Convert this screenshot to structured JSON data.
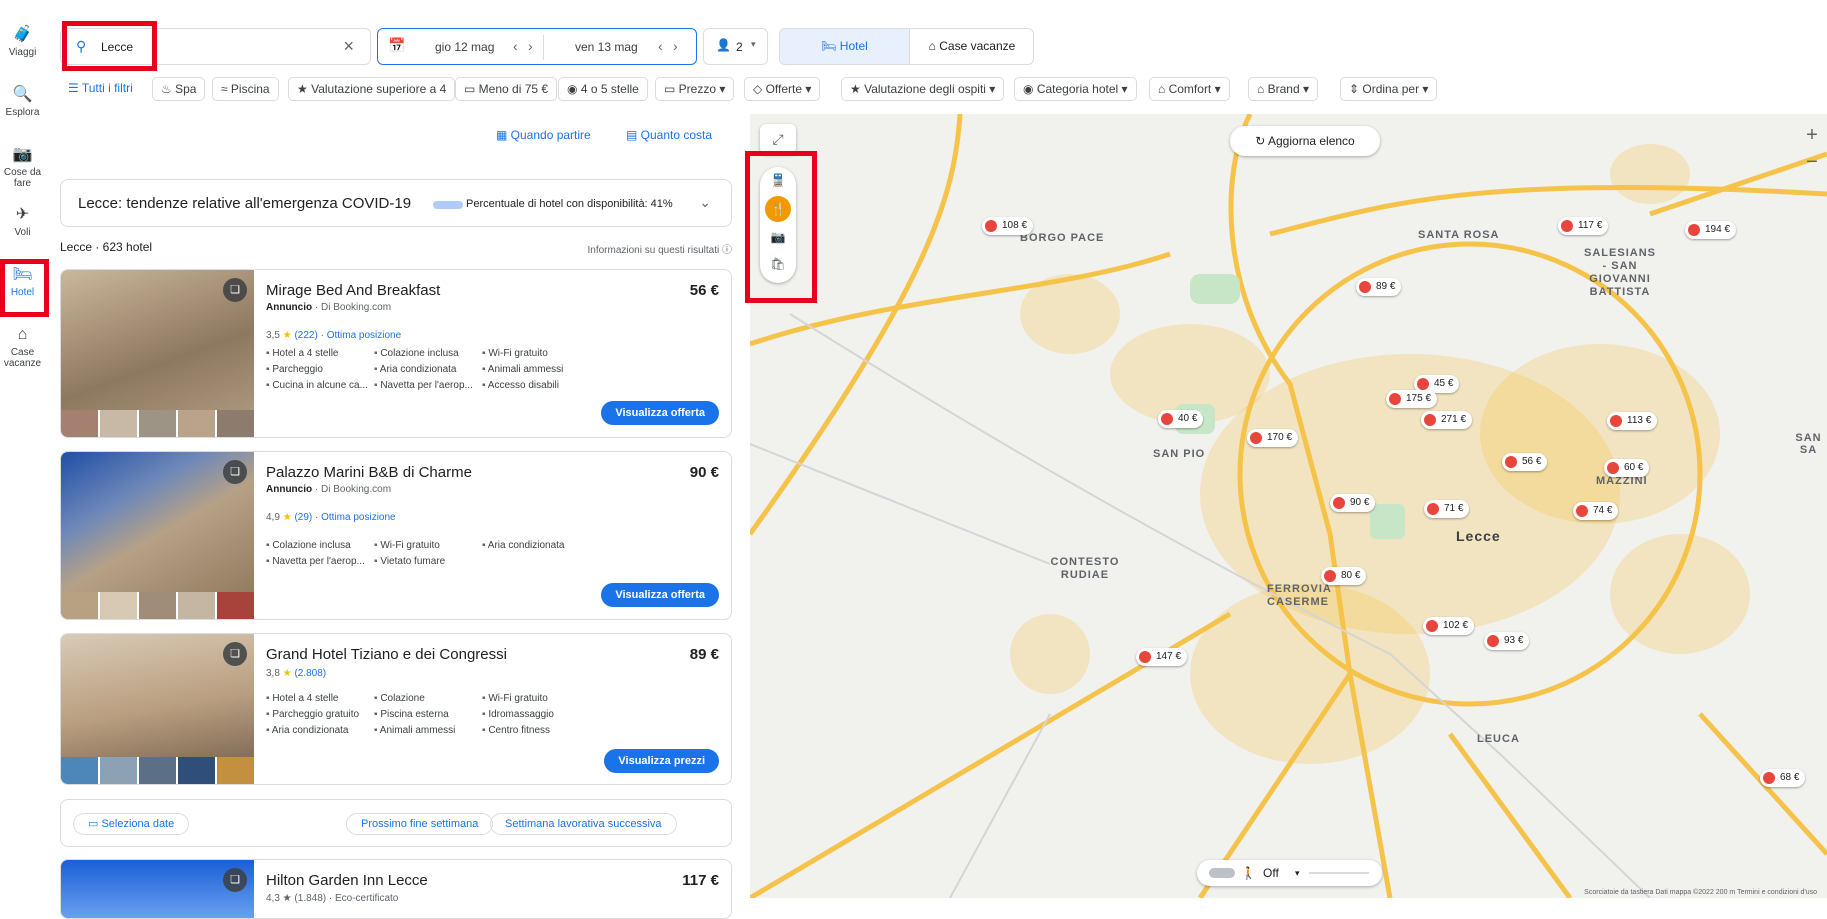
{
  "rail": [
    {
      "label": "Viaggi",
      "icon": "suitcase-icon"
    },
    {
      "label": "Esplora",
      "icon": "explore-icon"
    },
    {
      "label": "Cose da fare",
      "icon": "camera-icon"
    },
    {
      "label": "Voli",
      "icon": "plane-icon"
    },
    {
      "label": "Hotel",
      "icon": "bed-icon"
    },
    {
      "label": "Case vacanze",
      "icon": "house-icon"
    }
  ],
  "search": {
    "value": "Lecce"
  },
  "dates": {
    "checkin": "gio 12 mag",
    "checkout": "ven 13 mag"
  },
  "guests": "2",
  "type_toggle": {
    "hotel": "Hotel",
    "vacation": "Case vacanze"
  },
  "filters": [
    "Tutti i filtri",
    "Spa",
    "Piscina",
    "Valutazione superiore a 4",
    "Meno di 75 €",
    "4 o 5 stelle",
    "Prezzo",
    "Offerte",
    "Valutazione degli ospiti",
    "Categoria hotel",
    "Comfort",
    "Brand",
    "Ordina per"
  ],
  "links": {
    "when": "Quando partire",
    "cost": "Quanto costa"
  },
  "covid": {
    "title": "Lecce: tendenze relative all'emergenza COVID-19",
    "pct": "Percentuale di hotel con disponibilità: 41%"
  },
  "results": {
    "count": "Lecce · 623 hotel",
    "info": "Informazioni su questi risultati"
  },
  "hotels": [
    {
      "name": "Mirage Bed And Breakfast",
      "price": "56 €",
      "ad": "Annuncio",
      "source": "Di  Booking.com",
      "rating": "3,5",
      "reviews": "(222)",
      "tag": "Ottima posizione",
      "amenities": [
        "Hotel a 4 stelle",
        "Colazione inclusa",
        "Wi-Fi gratuito",
        "Parcheggio",
        "Aria condizionata",
        "Animali ammessi",
        "Cucina in alcune ca...",
        "Navetta per l'aerop...",
        "Accesso disabili"
      ],
      "button": "Visualizza offerta"
    },
    {
      "name": "Palazzo Marini B&B di Charme",
      "price": "90 €",
      "ad": "Annuncio",
      "source": "Di  Booking.com",
      "rating": "4,9",
      "reviews": "(29)",
      "tag": "Ottima posizione",
      "amenities": [
        "Colazione inclusa",
        "Wi-Fi gratuito",
        "Aria condizionata",
        "Navetta per l'aerop...",
        "Vietato fumare"
      ],
      "button": "Visualizza offerta"
    },
    {
      "name": "Grand Hotel Tiziano e dei Congressi",
      "price": "89 €",
      "rating": "3,8",
      "reviews": "(2.808)",
      "amenities": [
        "Hotel a 4 stelle",
        "Colazione",
        "Wi-Fi gratuito",
        "Parcheggio gratuito",
        "Piscina esterna",
        "Idromassaggio",
        "Aria condizionata",
        "Animali ammessi",
        "Centro fitness"
      ],
      "button": "Visualizza prezzi"
    }
  ],
  "date_chips": {
    "select": "Seleziona date",
    "weekend": "Prossimo fine settimana",
    "workweek": "Settimana lavorativa successiva"
  },
  "hotel4": {
    "name": "Hilton Garden Inn Lecce",
    "price": "117 €",
    "sub": "4,3 ★ (1.848) · Eco-certificato"
  },
  "map": {
    "refresh": "Aggiorna elenco",
    "walk": "Off",
    "areas": [
      "BORGO PACE",
      "SANTA ROSA",
      "SALESIANS - SAN GIOVANNI BATTISTA",
      "MAZZINI",
      "CONTESTO RUDIAE",
      "FERROVIA CASERME",
      "LEUCA",
      "Lecce",
      "SAN PIO",
      "SAN SA"
    ],
    "pins": [
      "108 €",
      "117 €",
      "194 €",
      "89 €",
      "45 €",
      "175 €",
      "271 €",
      "113 €",
      "40 €",
      "170 €",
      "56 €",
      "60 €",
      "90 €",
      "71 €",
      "74 €",
      "80 €",
      "102 €",
      "93 €",
      "147 €",
      "68 €"
    ],
    "footer": "Scorciatoie da tastiera   Dati mappa ©2022   200 m   Termini e condizioni d'uso"
  }
}
